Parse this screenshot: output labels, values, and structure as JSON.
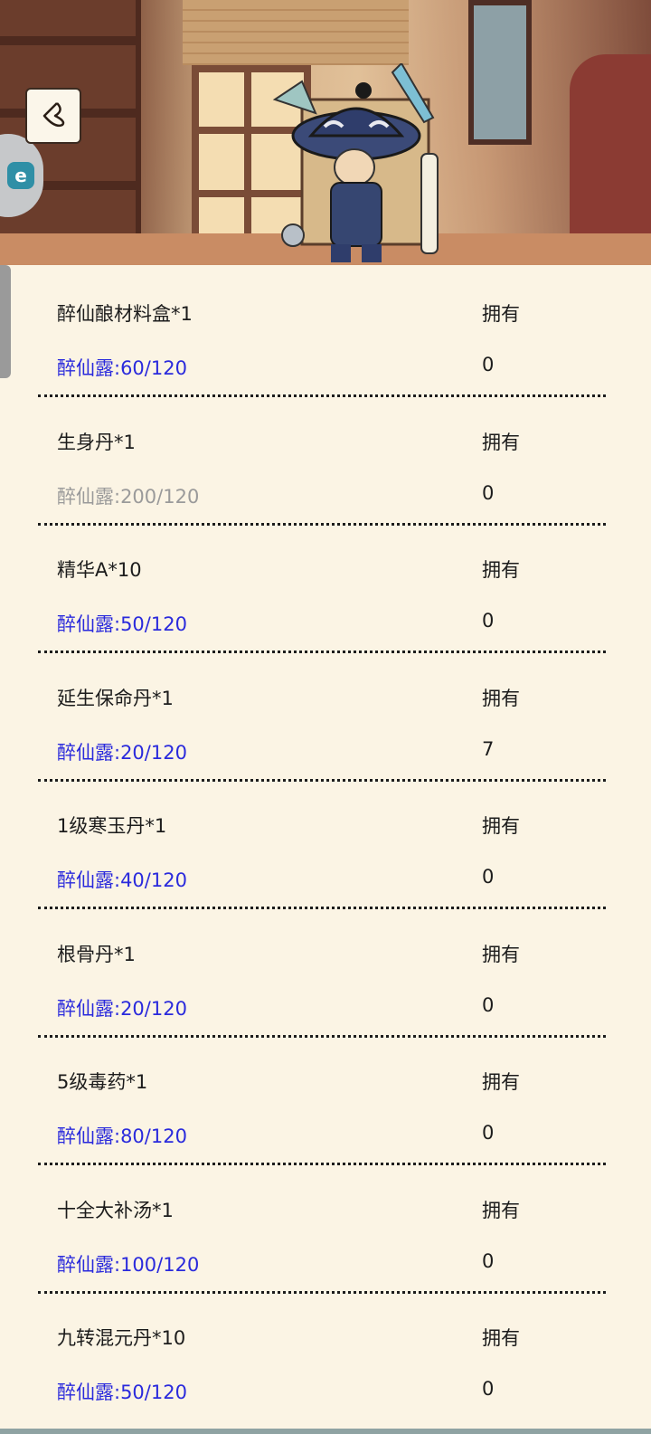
{
  "header": {
    "back_icon": "chevron-left-icon",
    "side_tab_glyph": "e"
  },
  "items": [
    {
      "name": "醉仙酿材料盒*1",
      "own_label": "拥有",
      "cost": "醉仙露:60/120",
      "owned": "0",
      "affordable": true
    },
    {
      "name": "生身丹*1",
      "own_label": "拥有",
      "cost": "醉仙露:200/120",
      "owned": "0",
      "affordable": false
    },
    {
      "name": "精华A*10",
      "own_label": "拥有",
      "cost": "醉仙露:50/120",
      "owned": "0",
      "affordable": true
    },
    {
      "name": "延生保命丹*1",
      "own_label": "拥有",
      "cost": "醉仙露:20/120",
      "owned": "7",
      "affordable": true
    },
    {
      "name": "1级寒玉丹*1",
      "own_label": "拥有",
      "cost": "醉仙露:40/120",
      "owned": "0",
      "affordable": true
    },
    {
      "name": "根骨丹*1",
      "own_label": "拥有",
      "cost": "醉仙露:20/120",
      "owned": "0",
      "affordable": true
    },
    {
      "name": "5级毒药*1",
      "own_label": "拥有",
      "cost": "醉仙露:80/120",
      "owned": "0",
      "affordable": true
    },
    {
      "name": "十全大补汤*1",
      "own_label": "拥有",
      "cost": "醉仙露:100/120",
      "owned": "0",
      "affordable": true
    },
    {
      "name": "九转混元丹*10",
      "own_label": "拥有",
      "cost": "醉仙露:50/120",
      "owned": "0",
      "affordable": true
    }
  ],
  "colors": {
    "affordable_cost": "#2a2adc",
    "unaffordable_cost": "#9a9a9a",
    "background": "#fbf4e4"
  }
}
